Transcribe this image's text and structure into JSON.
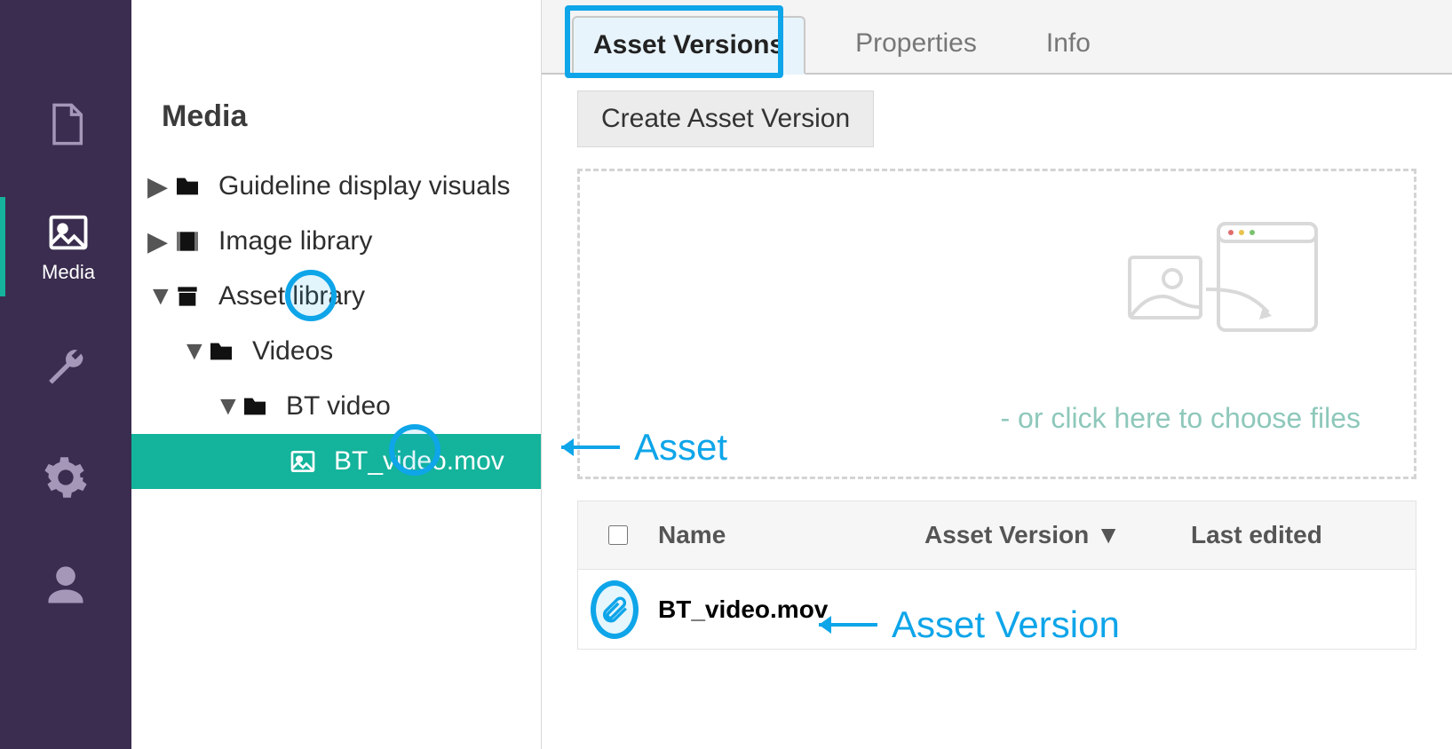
{
  "rail": {
    "items": [
      {
        "icon": "document-icon",
        "label": ""
      },
      {
        "icon": "image-icon",
        "label": "Media",
        "active": true
      },
      {
        "icon": "wrench-icon",
        "label": ""
      },
      {
        "icon": "gear-icon",
        "label": ""
      },
      {
        "icon": "user-icon",
        "label": ""
      }
    ]
  },
  "tree": {
    "title": "Media",
    "nodes": [
      {
        "indent": 18,
        "caret": "right",
        "icon": "folder-icon",
        "label": "Guideline display visuals"
      },
      {
        "indent": 18,
        "caret": "right",
        "icon": "film-icon",
        "label": "Image library"
      },
      {
        "indent": 18,
        "caret": "down",
        "icon": "archive-icon",
        "label": "Asset library",
        "ring": true
      },
      {
        "indent": 56,
        "caret": "down",
        "icon": "folder-icon",
        "label": "Videos"
      },
      {
        "indent": 94,
        "caret": "down",
        "icon": "folder-icon",
        "label": "BT video"
      },
      {
        "indent": 148,
        "caret": "",
        "icon": "asset-image-icon",
        "label": "BT_video.mov",
        "selected": true,
        "ring": true
      }
    ]
  },
  "tabs": {
    "items": [
      {
        "label": "Asset Versions",
        "active": true
      },
      {
        "label": "Properties"
      },
      {
        "label": "Info"
      }
    ]
  },
  "toolbar": {
    "create_label": "Create Asset Version"
  },
  "dropzone": {
    "hint": "- or click here to choose files"
  },
  "table": {
    "headers": {
      "name": "Name",
      "asset_version": "Asset Version",
      "last_edited": "Last edited"
    },
    "rows": [
      {
        "icon": "paperclip-icon",
        "name": "BT_video.mov"
      }
    ]
  },
  "annotations": {
    "asset": "Asset",
    "asset_version": "Asset Version"
  }
}
